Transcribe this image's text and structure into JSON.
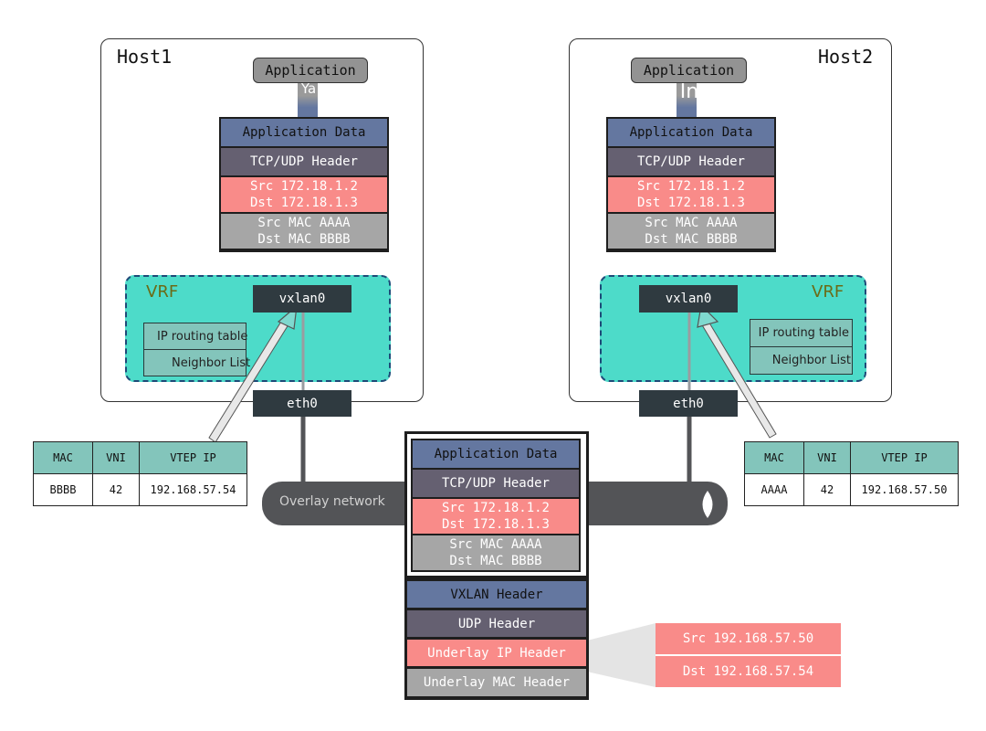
{
  "hosts": [
    {
      "title": "Host1",
      "application_label": "Application",
      "pipe_text": "Ya",
      "vrf_label": "VRF",
      "vxlan_iface": "vxlan0",
      "eth_iface": "eth0",
      "routing": [
        "IP routing table",
        "Neighbor List"
      ],
      "stack": {
        "app_data": "Application Data",
        "tcp_udp": "TCP/UDP Header",
        "ip_src": "Src 172.18.1.2",
        "ip_dst": "Dst 172.18.1.3",
        "mac_src": "Src MAC AAAA",
        "mac_dst": "Dst MAC BBBB"
      },
      "fdb_table": {
        "headers": [
          "MAC",
          "VNI",
          "VTEP IP"
        ],
        "rows": [
          [
            "BBBB",
            "42",
            "192.168.57.54"
          ]
        ]
      }
    },
    {
      "title": "Host2",
      "application_label": "Application",
      "pipe_text": "In",
      "vrf_label": "VRF",
      "vxlan_iface": "vxlan0",
      "eth_iface": "eth0",
      "routing": [
        "IP routing table",
        "Neighbor List"
      ],
      "stack": {
        "app_data": "Application Data",
        "tcp_udp": "TCP/UDP Header",
        "ip_src": "Src 172.18.1.2",
        "ip_dst": "Dst 172.18.1.3",
        "mac_src": "Src MAC AAAA",
        "mac_dst": "Dst MAC BBBB"
      },
      "fdb_table": {
        "headers": [
          "MAC",
          "VNI",
          "VTEP IP"
        ],
        "rows": [
          [
            "AAAA",
            "42",
            "192.168.57.50"
          ]
        ]
      }
    }
  ],
  "overlay": {
    "label": "Overlay network"
  },
  "encapsulated_packet": {
    "inner": {
      "app_data": "Application Data",
      "tcp_udp": "TCP/UDP Header",
      "ip_src": "Src 172.18.1.2",
      "ip_dst": "Dst 172.18.1.3",
      "mac_src": "Src MAC AAAA",
      "mac_dst": "Dst MAC BBBB"
    },
    "outer": {
      "vxlan": "VXLAN Header",
      "udp": "UDP Header",
      "underlay_ip": "Underlay IP Header",
      "underlay_mac": "Underlay MAC Header"
    },
    "underlay_ip_detail": {
      "src": "Src 192.168.57.50",
      "dst": "Dst 192.168.57.54"
    }
  },
  "colors": {
    "app_data": "#6477a0",
    "tcp_udp": "#656071",
    "ip_header": "#f98b89",
    "mac_header": "#a6a6a6",
    "vrf": "#4ddbc9",
    "interface": "#2f3a40",
    "overlay": "#535457"
  }
}
